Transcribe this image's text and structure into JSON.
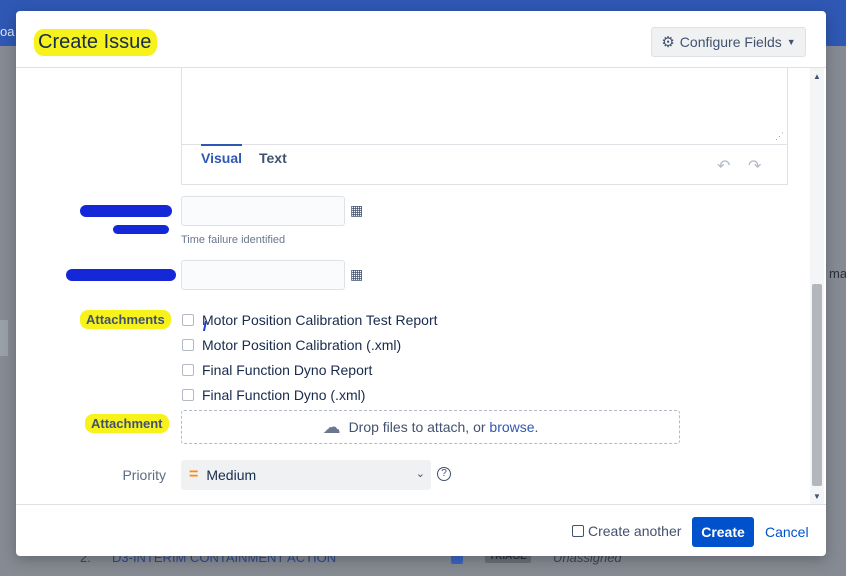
{
  "background": {
    "topbar_fragment": "oa",
    "row_number": "2.",
    "row_link": "D3-INTERIM CONTAINMENT ACTION",
    "row_badge": "TRIAGE",
    "row_assignee": "Unassigned",
    "right_fragment": "ma"
  },
  "dialog": {
    "title": "Create Issue",
    "configure_fields_label": "Configure Fields",
    "configure_icon": "gear-icon",
    "editor": {
      "tab_visual": "Visual",
      "tab_text": "Text"
    },
    "fields": {
      "date_help": "Time failure identified",
      "attachments_label": "Attachments",
      "checkboxes": [
        "Motor Position Calibration Test Report",
        "Motor Position Calibration (.xml)",
        "Final Function Dyno Report",
        "Final Function Dyno (.xml)"
      ],
      "attachment_label": "Attachment",
      "dropzone_text": "Drop files to attach, or",
      "dropzone_link": "browse",
      "dropzone_suffix": ".",
      "priority_label": "Priority",
      "priority_value": "Medium"
    },
    "footer": {
      "create_another": "Create another",
      "create": "Create",
      "cancel": "Cancel"
    }
  },
  "colors": {
    "primary": "#0052cc",
    "highlight": "#f7f21c",
    "redaction": "#1428d8",
    "priority_medium": "#ff8b00"
  }
}
